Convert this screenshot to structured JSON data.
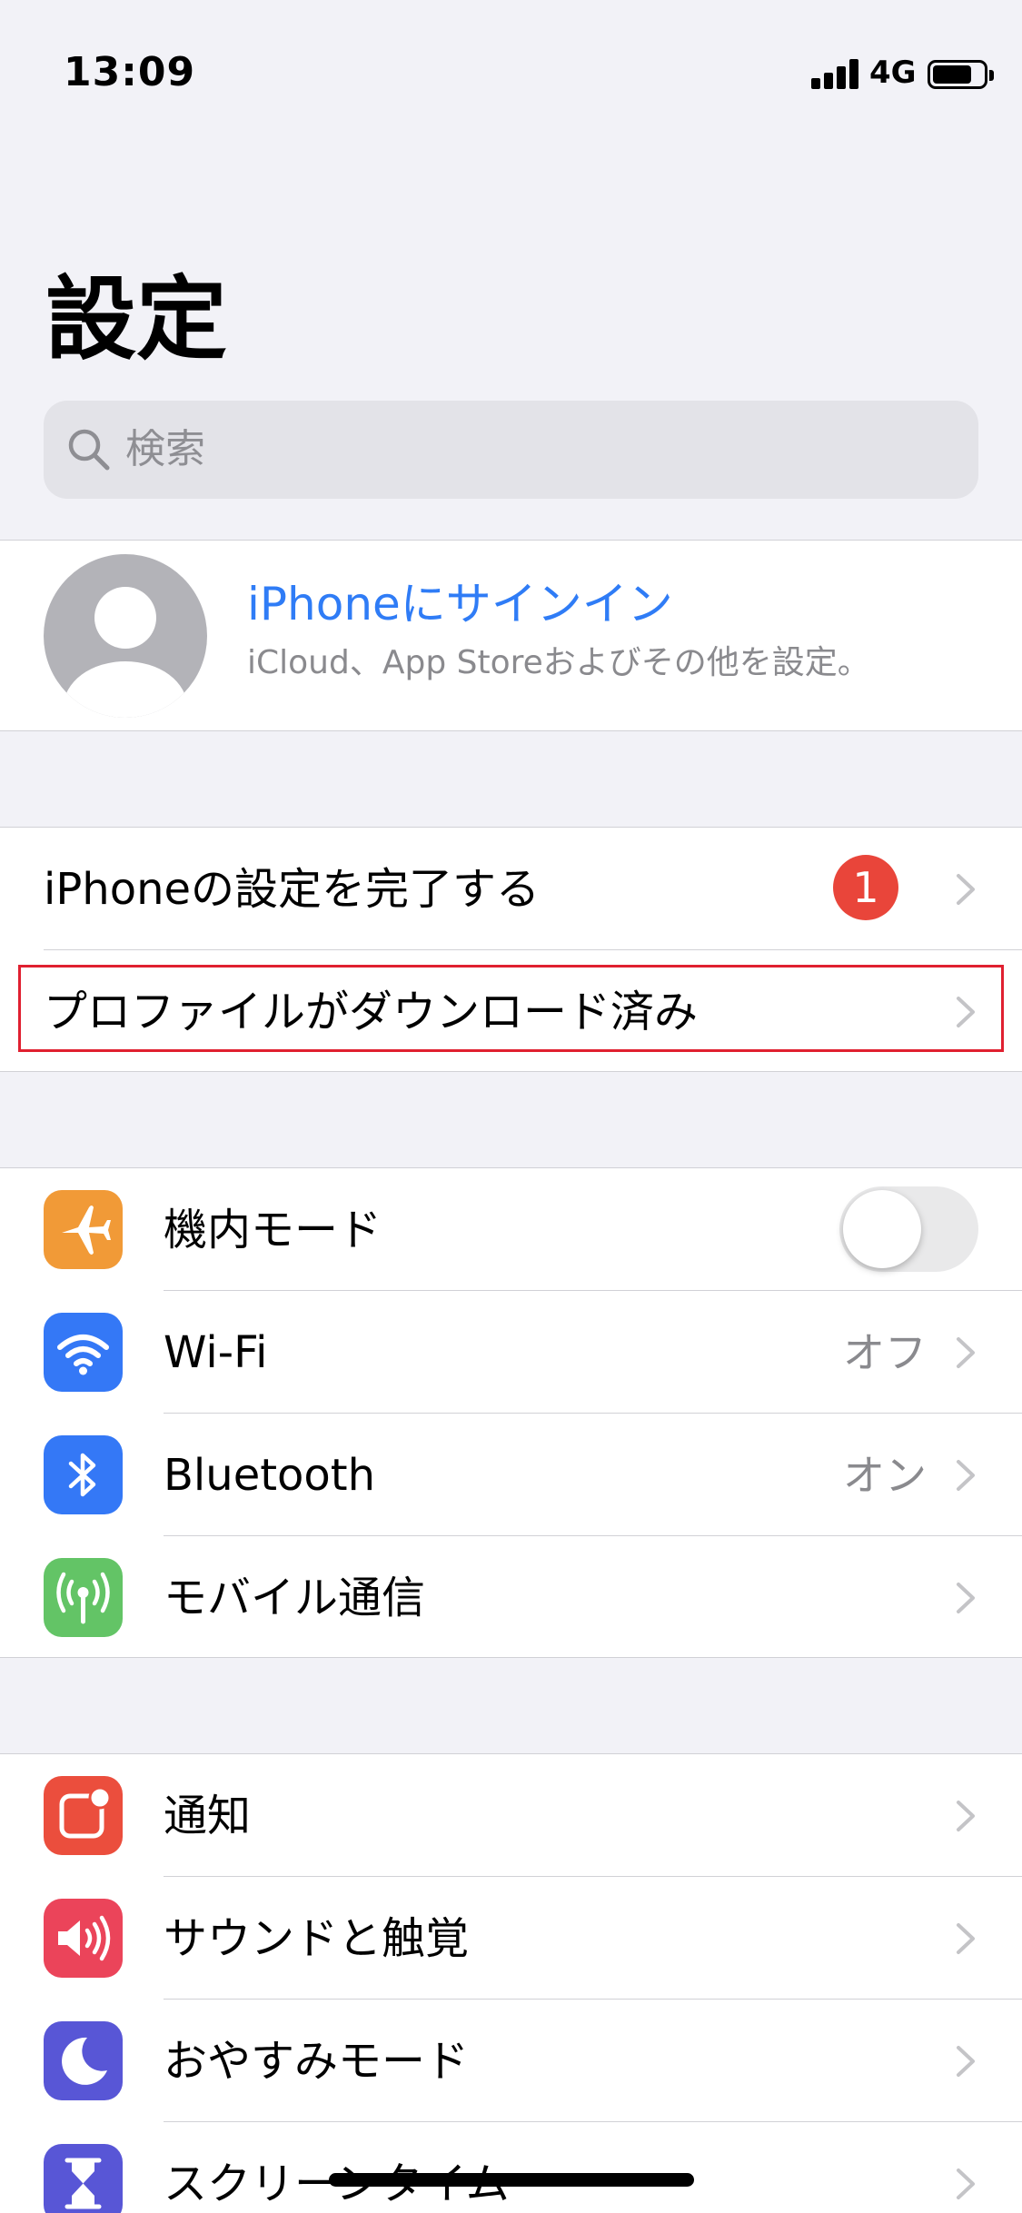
{
  "status_bar": {
    "time": "13:09",
    "network": "4G"
  },
  "header": {
    "title": "設定"
  },
  "search": {
    "placeholder": "検索"
  },
  "profile": {
    "title": "iPhoneにサインイン",
    "subtitle": "iCloud、App Storeおよびその他を設定。"
  },
  "setup_section": {
    "finish_setup": {
      "label": "iPhoneの設定を完了する",
      "badge": "1"
    },
    "profile_downloaded": {
      "label": "プロファイルがダウンロード済み"
    }
  },
  "connectivity_section": {
    "airplane": {
      "label": "機内モード",
      "toggle_on": false,
      "icon": "airplane-icon",
      "color": "#f19a37"
    },
    "wifi": {
      "label": "Wi-Fi",
      "value": "オフ",
      "icon": "wifi-icon",
      "color": "#3478f6"
    },
    "bluetooth": {
      "label": "Bluetooth",
      "value": "オン",
      "icon": "bluetooth-icon",
      "color": "#3478f6"
    },
    "cellular": {
      "label": "モバイル通信",
      "icon": "antenna-icon",
      "color": "#63c466"
    }
  },
  "general_section": {
    "notifications": {
      "label": "通知",
      "icon": "notification-icon",
      "color": "#eb4e3d"
    },
    "sounds": {
      "label": "サウンドと触覚",
      "icon": "speaker-icon",
      "color": "#eb445a"
    },
    "do_not_disturb": {
      "label": "おやすみモード",
      "icon": "moon-icon",
      "color": "#5856d6"
    },
    "screen_time": {
      "label": "スクリーンタイム",
      "icon": "hourglass-icon",
      "color": "#5856d6"
    }
  },
  "colors": {
    "accent": "#2f7cf6",
    "badge": "#e9453a",
    "highlight_border": "#e02030",
    "background": "#f2f2f7"
  }
}
